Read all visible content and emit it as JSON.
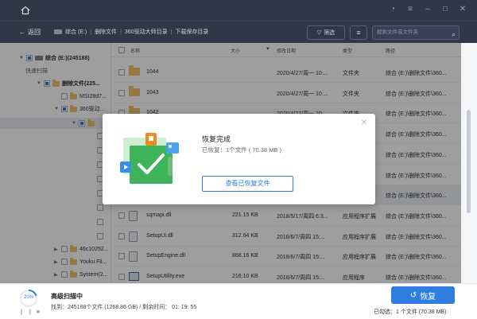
{
  "colors": {
    "accent": "#2f7de1",
    "titlebar": "#2f3847",
    "folder": "#f2c46b"
  },
  "nav": {
    "back_label": "返回",
    "breadcrumbs": [
      "综合 (E:)",
      "删除文件",
      "360驱动大师目录",
      "下载保存目录"
    ],
    "filter_label": "筛选",
    "search_placeholder": "搜索文件或文件夹"
  },
  "sidebar": {
    "drive_label": "综合 (E:)(245188)",
    "quick_scan_label": "快速扫描",
    "deleted_label": "删除文件(225...",
    "items": [
      "MSI28d7...",
      "360驱动...",
      "46c10252...",
      "Youku Fil...",
      "System(2..."
    ]
  },
  "columns": {
    "name": "名称",
    "size": "大小",
    "date": "修改日期",
    "type": "类型",
    "path": "路径"
  },
  "files": [
    {
      "name": "1044",
      "icon": "folder-icon",
      "size": "",
      "date": "2020/4/27/周一 10:...",
      "type": "文件夹",
      "path": "综合 (E:)\\删除文件\\360..."
    },
    {
      "name": "1043",
      "icon": "folder-icon",
      "size": "",
      "date": "2020/4/27/周一 10:...",
      "type": "文件夹",
      "path": "综合 (E:)\\删除文件\\360..."
    },
    {
      "name": "1042",
      "icon": "folder-icon",
      "size": "",
      "date": "2020/4/27/周一 10:...",
      "type": "文件夹",
      "path": "综合 (E:)\\删除文件\\360..."
    },
    {
      "name": "",
      "icon": "folder-icon",
      "size": "",
      "date": "",
      "type": "",
      "path": "综合 (E:)\\删除文件\\360..."
    },
    {
      "name": "",
      "icon": "folder-icon",
      "size": "",
      "date": "",
      "type": "",
      "path": "综合 (E:)\\删除文件\\360..."
    },
    {
      "name": "",
      "icon": "folder-icon",
      "size": "",
      "date": "",
      "type": "",
      "path": "综合 (E:)\\删除文件\\360..."
    },
    {
      "name": "",
      "icon": "folder-icon",
      "size": "",
      "date": "",
      "type": "",
      "path": "综合 (E:)\\删除文件\\360..."
    },
    {
      "name": "sqmapi.dll",
      "icon": "dll-icon",
      "size": "221.15 KB",
      "date": "2018/5/17/周四 6:3...",
      "type": "应用程序扩展",
      "path": "综合 (E:)\\删除文件\\360..."
    },
    {
      "name": "SetupUi.dll",
      "icon": "dll-icon",
      "size": "312.64 KB",
      "date": "2018/6/7/周四 15:...",
      "type": "应用程序扩展",
      "path": "综合 (E:)\\删除文件\\360..."
    },
    {
      "name": "SetupEngine.dll",
      "icon": "dll-icon",
      "size": "868.16 KB",
      "date": "2018/6/7/周四 15:...",
      "type": "应用程序扩展",
      "path": "综合 (E:)\\删除文件\\360..."
    },
    {
      "name": "SetupUtility.exe",
      "icon": "exe-icon",
      "size": "216.10 KB",
      "date": "2018/6/7/周四 15:...",
      "type": "应用程序",
      "path": "综合 (E:)\\删除文件\\360..."
    }
  ],
  "dialog": {
    "title": "恢复完成",
    "subtitle": "已恢复：1个文件 ( 70.38 MB )",
    "button_label": "查看已恢复文件"
  },
  "status": {
    "progress_percent": 20,
    "progress_label": "20%",
    "scan_title": "高级扫描中",
    "scan_stats": "找到：245188个文件 (1268.86 GB) / 剩余时间： 01: 19: 55",
    "recover_label": "恢复",
    "selected_info": "已勾选：1 个文件 (70.38 MB)"
  }
}
